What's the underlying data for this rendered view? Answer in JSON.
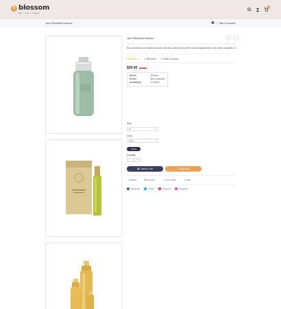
{
  "header": {
    "logo_mark": "b",
    "logo_name": "blossom",
    "logo_tagline": "skin · care · surgery",
    "icons": [
      "search-icon",
      "user-icon",
      "cart-icon"
    ],
    "cart_count": "0"
  },
  "breadcrumb": {
    "left": "Jazz Rimbella Sunsoe",
    "home_icon": "home-icon",
    "separator": "›",
    "current": "Bio Cosmetic"
  },
  "gallery": {
    "images": [
      "serum-pump-bottle",
      "perfume-box-and-rollerball",
      "gold-oil-bottles"
    ]
  },
  "product": {
    "title": "Jazz Rimbella Sunsoe",
    "prev": "‹",
    "next": "›",
    "description": "Bio-cosmetics are those products that are made purely from natural ingredients, and which originate, re...",
    "stars": "★★★★☆",
    "reviews_label": "1 REVIEW",
    "write_review_label": "Write a review",
    "price": "$29.00",
    "old_price": "$42.00",
    "specs": [
      {
        "key": "Brand:",
        "value": "Friberd"
      },
      {
        "key": "Model:",
        "value": "Bio Cosmetic"
      },
      {
        "key": "Availability:",
        "value": "In Stock"
      }
    ],
    "size_label": "Size",
    "size_value": "M",
    "color_label": "Color",
    "color_value": "green",
    "color_pill": "Yellow",
    "quantity_label": "Quantity",
    "qty_minus": "−",
    "qty_value": "1",
    "qty_plus": "+",
    "add_to_cart_label": "Add to Cart",
    "buy_now_label": "Buy Now",
    "links": [
      "Wishlist",
      "Compare",
      "Size Guide",
      "Mail"
    ],
    "share": [
      {
        "label": "Facebook",
        "color": "#3b5998"
      },
      {
        "label": "Twitter",
        "color": "#1da1f2"
      },
      {
        "label": "Pinterest",
        "color": "#cb2027"
      },
      {
        "label": "Instagram",
        "color": "#d6249f"
      }
    ]
  },
  "colors": {
    "header_bg": "#efe7e6",
    "accent": "#eca154",
    "dark_button": "#3a3d5e"
  }
}
